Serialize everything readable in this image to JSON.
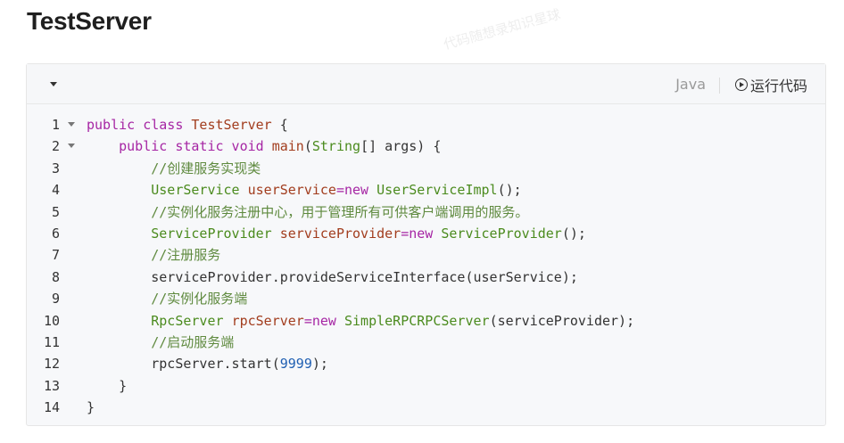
{
  "page": {
    "title": "TestServer"
  },
  "toolbar": {
    "language": "Java",
    "run_label": "运行代码"
  },
  "code_lines": [
    {
      "num": "1",
      "foldable": true,
      "tokens": [
        {
          "t": "k",
          "s": "public class "
        },
        {
          "t": "v",
          "s": "TestServer"
        },
        {
          "t": "p",
          "s": " {"
        }
      ]
    },
    {
      "num": "2",
      "foldable": true,
      "tokens": [
        {
          "t": "p",
          "s": "    "
        },
        {
          "t": "k",
          "s": "public static void "
        },
        {
          "t": "v",
          "s": "main"
        },
        {
          "t": "p",
          "s": "("
        },
        {
          "t": "t",
          "s": "String"
        },
        {
          "t": "p",
          "s": "[] args) {"
        }
      ]
    },
    {
      "num": "3",
      "foldable": false,
      "tokens": [
        {
          "t": "p",
          "s": "        "
        },
        {
          "t": "c",
          "s": "//创建服务实现类"
        }
      ]
    },
    {
      "num": "4",
      "foldable": false,
      "tokens": [
        {
          "t": "p",
          "s": "        "
        },
        {
          "t": "t",
          "s": "UserService"
        },
        {
          "t": "p",
          "s": " "
        },
        {
          "t": "v",
          "s": "userService"
        },
        {
          "t": "k",
          "s": "=new "
        },
        {
          "t": "t",
          "s": "UserServiceImpl"
        },
        {
          "t": "p",
          "s": "();"
        }
      ]
    },
    {
      "num": "5",
      "foldable": false,
      "tokens": [
        {
          "t": "p",
          "s": "        "
        },
        {
          "t": "c",
          "s": "//实例化服务注册中心，用于管理所有可供客户端调用的服务。"
        }
      ]
    },
    {
      "num": "6",
      "foldable": false,
      "tokens": [
        {
          "t": "p",
          "s": "        "
        },
        {
          "t": "t",
          "s": "ServiceProvider"
        },
        {
          "t": "p",
          "s": " "
        },
        {
          "t": "v",
          "s": "serviceProvider"
        },
        {
          "t": "k",
          "s": "=new "
        },
        {
          "t": "t",
          "s": "ServiceProvider"
        },
        {
          "t": "p",
          "s": "();"
        }
      ]
    },
    {
      "num": "7",
      "foldable": false,
      "tokens": [
        {
          "t": "p",
          "s": "        "
        },
        {
          "t": "c",
          "s": "//注册服务"
        }
      ]
    },
    {
      "num": "8",
      "foldable": false,
      "tokens": [
        {
          "t": "p",
          "s": "        serviceProvider.provideServiceInterface(userService);"
        }
      ]
    },
    {
      "num": "9",
      "foldable": false,
      "tokens": [
        {
          "t": "p",
          "s": "        "
        },
        {
          "t": "c",
          "s": "//实例化服务端"
        }
      ]
    },
    {
      "num": "10",
      "foldable": false,
      "tokens": [
        {
          "t": "p",
          "s": "        "
        },
        {
          "t": "t",
          "s": "RpcServer"
        },
        {
          "t": "p",
          "s": " "
        },
        {
          "t": "v",
          "s": "rpcServer"
        },
        {
          "t": "k",
          "s": "=new "
        },
        {
          "t": "t",
          "s": "SimpleRPCRPCServer"
        },
        {
          "t": "p",
          "s": "(serviceProvider);"
        }
      ]
    },
    {
      "num": "11",
      "foldable": false,
      "tokens": [
        {
          "t": "p",
          "s": "        "
        },
        {
          "t": "c",
          "s": "//启动服务端"
        }
      ]
    },
    {
      "num": "12",
      "foldable": false,
      "tokens": [
        {
          "t": "p",
          "s": "        rpcServer.start("
        },
        {
          "t": "n",
          "s": "9999"
        },
        {
          "t": "p",
          "s": ");"
        }
      ]
    },
    {
      "num": "13",
      "foldable": false,
      "tokens": [
        {
          "t": "p",
          "s": "    }"
        }
      ]
    },
    {
      "num": "14",
      "foldable": false,
      "tokens": [
        {
          "t": "p",
          "s": "}"
        }
      ]
    }
  ],
  "watermark": {
    "text": "代码随想录知识星球"
  },
  "colors": {
    "keyword": "#a626a4",
    "type": "#4b8b1e",
    "variable": "#a23d1e",
    "comment": "#5f8a3f",
    "number": "#1f5fb2"
  }
}
